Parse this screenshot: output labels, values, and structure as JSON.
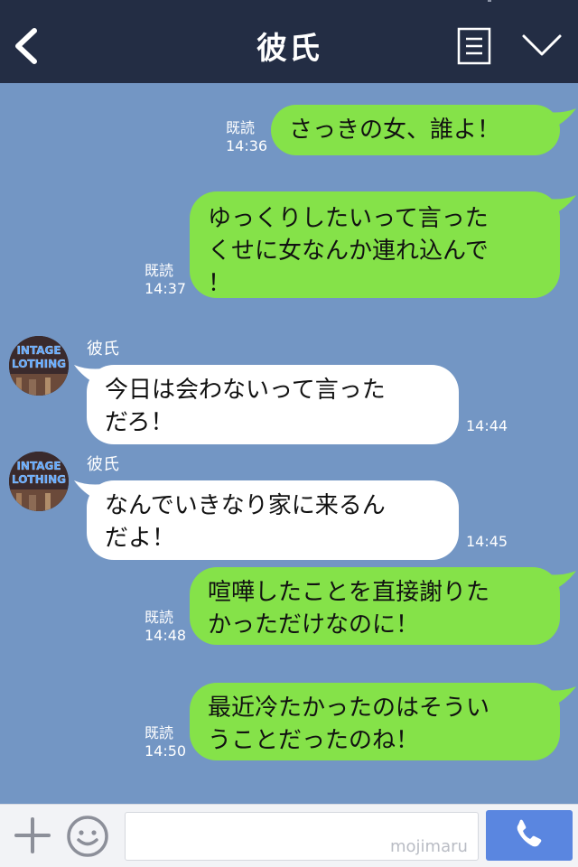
{
  "header": {
    "title": "彼氏",
    "back_icon": "chevron-left-icon",
    "menu_icon": "list-menu-icon",
    "collapse_icon": "chevron-down-icon"
  },
  "messages": [
    {
      "side": "sent",
      "read_label": "既読",
      "time": "14:36",
      "text": "さっきの女、誰よ！"
    },
    {
      "side": "sent",
      "read_label": "既読",
      "time": "14:37",
      "text": "ゆっくりしたいって言った\nくせに女なんか連れ込んで\n！"
    },
    {
      "side": "received",
      "sender": "彼氏",
      "time": "14:44",
      "text": "今日は会わないって言った\nだろ！"
    },
    {
      "side": "received",
      "sender": "彼氏",
      "time": "14:45",
      "text": "なんでいきなり家に来るん\nだよ！"
    },
    {
      "side": "sent",
      "read_label": "既読",
      "time": "14:48",
      "text": "喧嘩したことを直接謝りた\nかっただけなのに！"
    },
    {
      "side": "sent",
      "read_label": "既読",
      "time": "14:50",
      "text": "最近冷たかったのはそうい\nうことだったのね！"
    }
  ],
  "avatar": {
    "text_line1": "INTAGE",
    "text_line2": "LOTHING"
  },
  "footer": {
    "input_value": "",
    "input_placeholder": "",
    "watermark": "mojimaru",
    "plus_icon": "plus-icon",
    "emoji_icon": "smiley-icon",
    "call_icon": "phone-icon"
  },
  "colors": {
    "header_bg": "#232d44",
    "chat_bg": "#7396c4",
    "sent_bubble": "#85e249",
    "received_bubble": "#ffffff",
    "call_button": "#5a86e0"
  }
}
